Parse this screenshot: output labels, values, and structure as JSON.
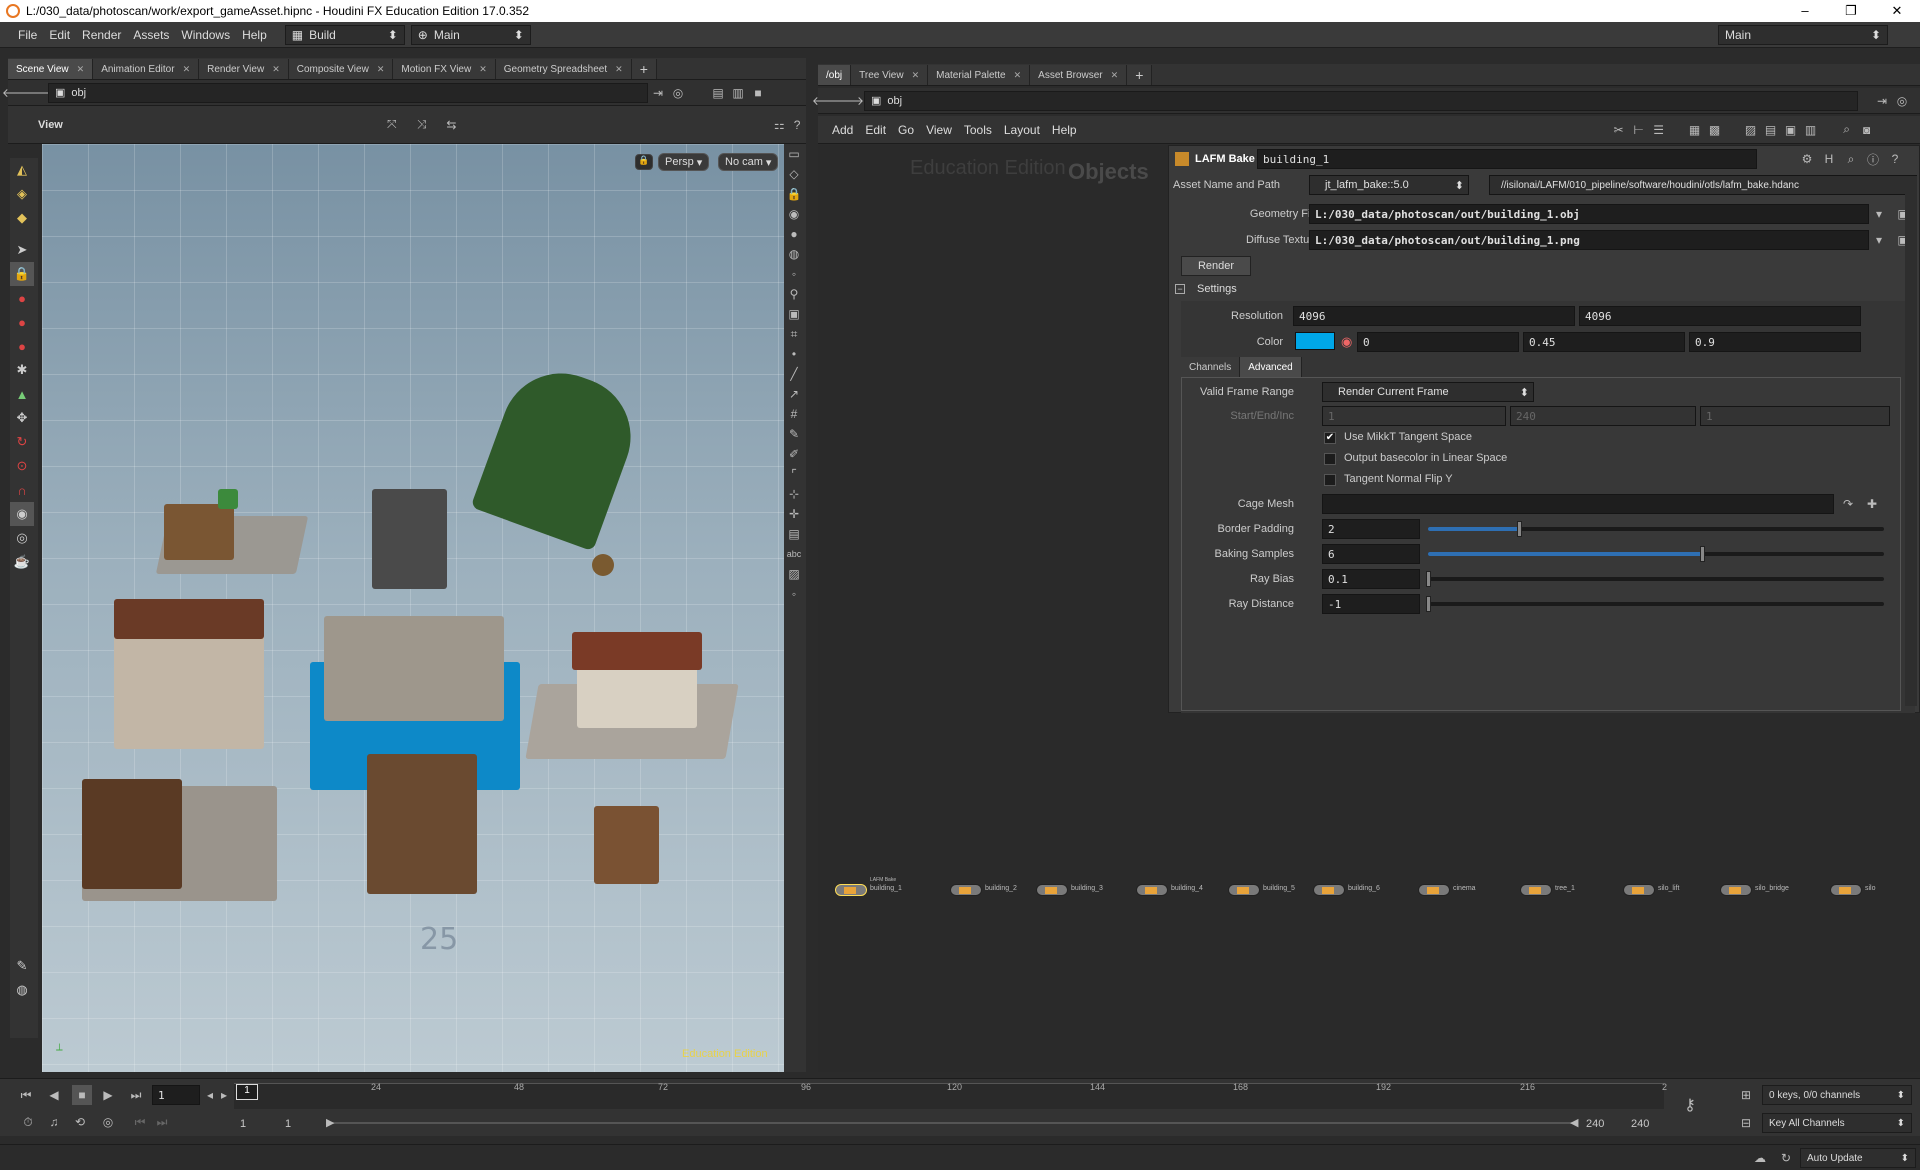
{
  "titlebar": {
    "title": "L:/030_data/photoscan/work/export_gameAsset.hipnc - Houdini FX Education Edition 17.0.352"
  },
  "menubar": {
    "items": [
      "File",
      "Edit",
      "Render",
      "Assets",
      "Windows",
      "Help"
    ],
    "shelf_set": "Build",
    "desktop": "Main",
    "right_desktop": "Main"
  },
  "left_pane": {
    "tabs": [
      "Scene View",
      "Animation Editor",
      "Render View",
      "Composite View",
      "Motion FX View",
      "Geometry Spreadsheet"
    ],
    "path": "obj",
    "view_label": "View",
    "persp": "Persp",
    "cam": "No cam",
    "watermark": "Education Edition",
    "grid_label": "25"
  },
  "right_pane": {
    "tabs": [
      "/obj",
      "Tree View",
      "Material Palette",
      "Asset Browser"
    ],
    "path": "obj",
    "menu": [
      "Add",
      "Edit",
      "Go",
      "View",
      "Tools",
      "Layout",
      "Help"
    ],
    "network_watermark": "Education Edition",
    "network_context": "Objects"
  },
  "params": {
    "node_type": "LAFM Bake",
    "node_name": "building_1",
    "asset_label": "Asset Name and Path",
    "asset_name": "jt_lafm_bake::5.0",
    "asset_path": "//isilonai/LAFM/010_pipeline/software/houdini/otls/lafm_bake.hdanc",
    "geometry_label": "Geometry File",
    "geometry_value": "L:/030_data/photoscan/out/building_1.obj",
    "diffuse_label": "Diffuse Texture",
    "diffuse_value": "L:/030_data/photoscan/out/building_1.png",
    "render_button": "Render",
    "settings_label": "Settings",
    "resolution_label": "Resolution",
    "res_x": "4096",
    "res_y": "4096",
    "color_label": "Color",
    "color_swatch": "#00a7e8",
    "color_r": "0",
    "color_g": "0.45",
    "color_b": "0.9",
    "subtabs": [
      "Channels",
      "Advanced"
    ],
    "frame_range_label": "Valid Frame Range",
    "frame_range_value": "Render Current Frame",
    "startend_label": "Start/End/Inc",
    "start": "1",
    "end": "240",
    "inc": "1",
    "mikkt_label": "Use MikkT Tangent Space",
    "linear_label": "Output basecolor in Linear Space",
    "flip_label": "Tangent Normal Flip Y",
    "cage_label": "Cage Mesh",
    "border_label": "Border Padding",
    "border_value": "2",
    "samples_label": "Baking Samples",
    "samples_value": "6",
    "bias_label": "Ray Bias",
    "bias_value": "0.1",
    "distance_label": "Ray Distance",
    "distance_value": "-1"
  },
  "nodes": [
    "building_1",
    "building_2",
    "building_3",
    "building_4",
    "building_5",
    "building_6",
    "cinema",
    "tree_1",
    "silo_lift",
    "silo_bridge",
    "silo"
  ],
  "node_type_small": "LAFM Bake",
  "timeline": {
    "frame": "1",
    "ticks": [
      "24",
      "48",
      "72",
      "96",
      "120",
      "144",
      "168",
      "192",
      "216",
      "2"
    ],
    "range_start": "1",
    "range_start2": "1",
    "range_end": "240",
    "range_end2": "240",
    "channels": "0 keys, 0/0 channels",
    "key_all": "Key All Channels",
    "auto_update": "Auto Update"
  }
}
